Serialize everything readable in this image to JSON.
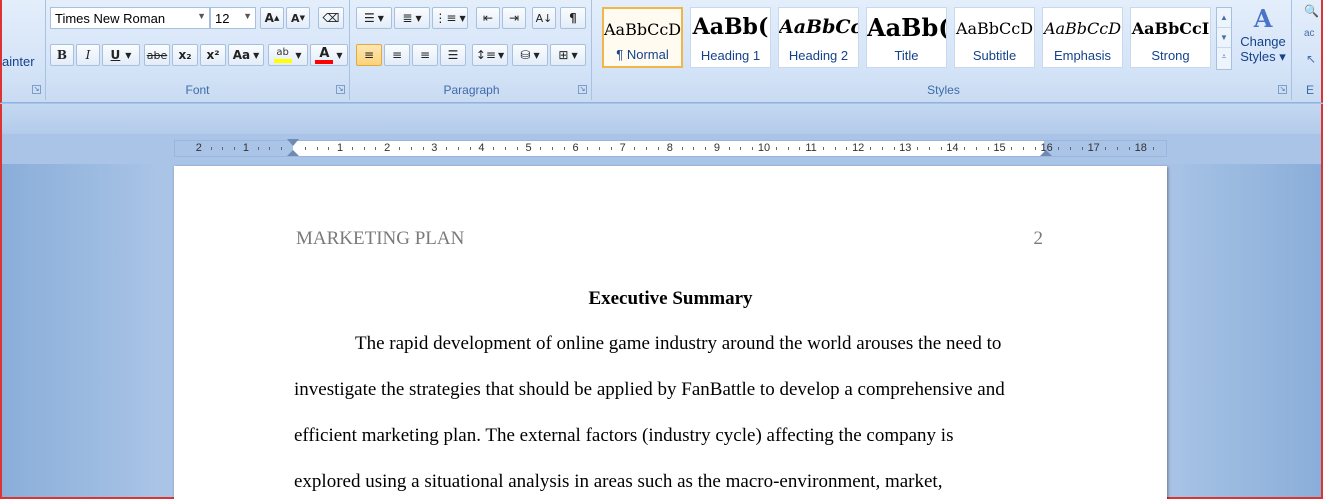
{
  "clipboard": {
    "format_painter_partial": "ainter"
  },
  "font": {
    "group_label": "Font",
    "font_name": "Times New Roman",
    "font_size": "12",
    "grow": "A",
    "shrink": "A",
    "bold": "B",
    "italic": "I",
    "underline": "U",
    "strike": "abe",
    "subscript": "x₂",
    "superscript": "x²",
    "change_case": "Aa",
    "highlight_color": "#ffff00",
    "font_color": "#ff0000"
  },
  "paragraph": {
    "group_label": "Paragraph"
  },
  "styles": {
    "group_label": "Styles",
    "tiles": [
      {
        "sample": "AaBbCcD",
        "name": "¶ Normal"
      },
      {
        "sample": "AaBb(",
        "name": "Heading 1"
      },
      {
        "sample": "AaBbCc",
        "name": "Heading 2"
      },
      {
        "sample": "AaBb(",
        "name": "Title"
      },
      {
        "sample": "AaBbCcD",
        "name": "Subtitle"
      },
      {
        "sample": "AaBbCcD",
        "name": "Emphasis"
      },
      {
        "sample": "AaBbCcI",
        "name": "Strong"
      }
    ],
    "change_styles_line1": "Change",
    "change_styles_line2": "Styles ▾"
  },
  "editing": {
    "group_label_partial": "E"
  },
  "ruler": {
    "left_numbers": [
      "2",
      "1"
    ],
    "right_numbers": [
      "1",
      "2",
      "3",
      "4",
      "5",
      "6",
      "7",
      "8",
      "9",
      "10",
      "11",
      "12",
      "13",
      "14",
      "15",
      "16",
      "17",
      "18"
    ]
  },
  "document": {
    "header_left": "MARKETING PLAN",
    "header_page": "2",
    "heading": "Executive Summary",
    "lines": [
      "The rapid development of online game industry around the world arouses the need to",
      "investigate the strategies that should be applied by FanBattle to develop a comprehensive and",
      "efficient marketing plan. The external factors (industry cycle) affecting the company  is",
      "explored using a situational analysis in areas such as the macro-environment, market,"
    ]
  }
}
